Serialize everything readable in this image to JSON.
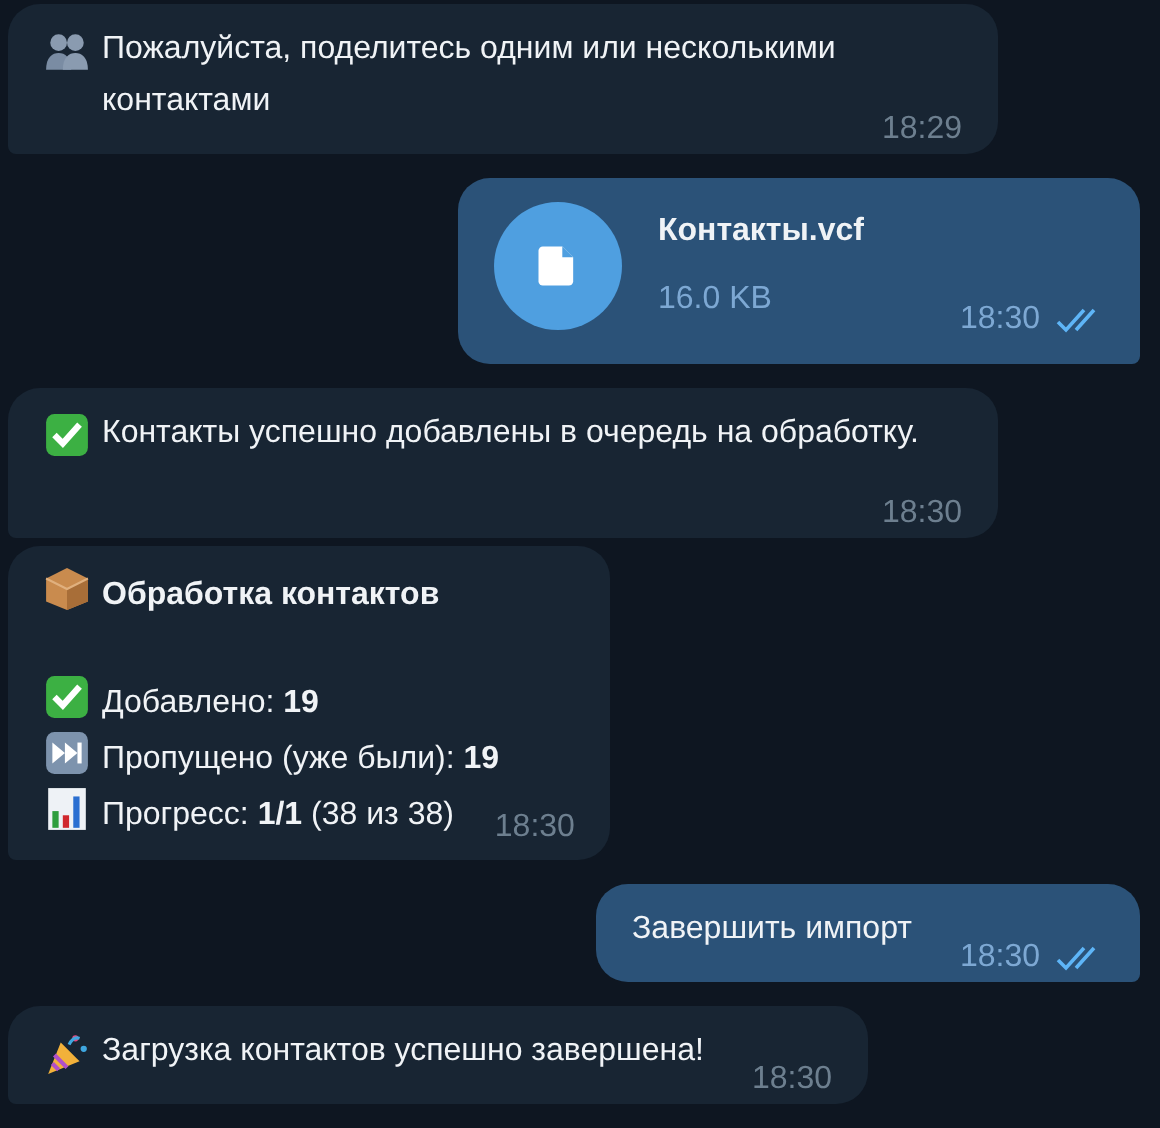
{
  "messages": [
    {
      "kind": "text",
      "outgoing": false,
      "text": "Пожалуйста, поделитесь одним или несколькими контактами",
      "time": "18:29"
    },
    {
      "kind": "file",
      "outgoing": true,
      "name": "Контакты.vcf",
      "size": "16.0 KB",
      "time": "18:30",
      "read": true
    },
    {
      "kind": "text",
      "outgoing": false,
      "text": "Контакты успешно добавлены в очередь на обработку.",
      "time": "18:30"
    },
    {
      "kind": "stats",
      "outgoing": false,
      "title": "Обработка контактов",
      "lines": [
        "Добавлено: **19**",
        "Пропущено (уже были): **19**",
        "Прогресс: **1/1** (38 из 38)"
      ],
      "time": "18:30"
    },
    {
      "kind": "text",
      "outgoing": true,
      "text": "Завершить импорт",
      "time": "18:30",
      "read": true
    },
    {
      "kind": "text",
      "outgoing": false,
      "text": "Загрузка контактов успешно завершена!",
      "time": "18:30"
    }
  ]
}
